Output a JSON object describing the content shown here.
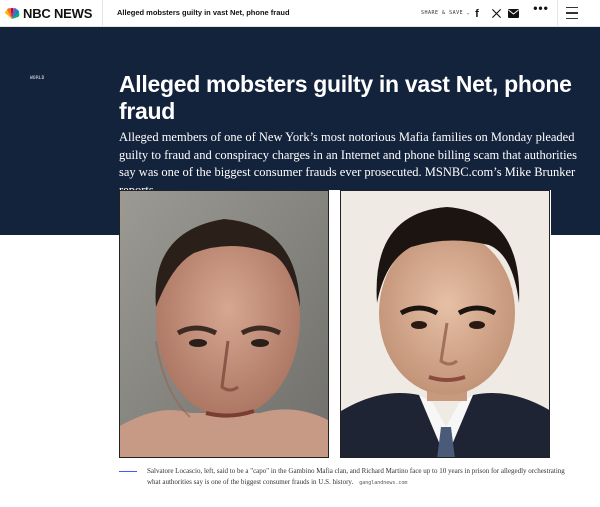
{
  "nav": {
    "logo": "NBC NEWS",
    "article_title": "Alleged mobsters guilty in vast Net, phone fraud",
    "share_label": "SHARE & SAVE",
    "share_chevron": "—",
    "icons": [
      "peacock-logo-icon",
      "facebook-icon",
      "x-twitter-icon",
      "email-icon",
      "more-icon",
      "menu-icon"
    ],
    "facebook_glyph": "f",
    "x_glyph": "𝕏",
    "more_glyph": "•••"
  },
  "hero": {
    "section": "WORLD",
    "headline": "Alleged mobsters guilty in vast Net, phone fraud",
    "dek": "Alleged members of one of New York’s most notorious Mafia families on Monday pleaded guilty to fraud and conspiracy charges in an Internet and phone billing scam that authorities say was one of the biggest consumer frauds ever prosecuted. MSNBC.com’s Mike Brunker reports.",
    "background_color": "#14233c"
  },
  "photo": {
    "caption": "Salvatore Locascio, left, said to be a \"capo\" in the Gambino Mafia clan, and Richard Martino face up to 10 years in prison for allegedly orchestrating what authorities say is one of the biggest consumer frauds in U.S. history.",
    "credit": "ganglandnews.com"
  },
  "colors": {
    "accent": "#3061ff",
    "navy": "#14233c"
  }
}
